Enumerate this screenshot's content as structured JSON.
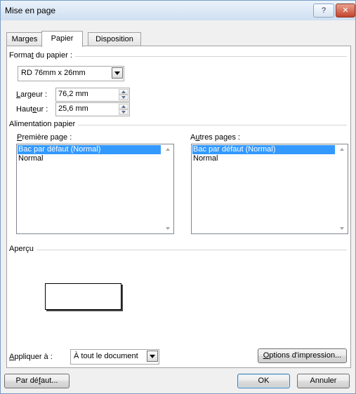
{
  "window": {
    "title": "Mise en page",
    "help_label": "?",
    "close_label": "✕"
  },
  "tabs": [
    {
      "label": "Marges"
    },
    {
      "label": "Papier"
    },
    {
      "label": "Disposition"
    }
  ],
  "format": {
    "group_pre": "Forma",
    "group_acc": "t",
    "group_post": " du papier :",
    "paper_value": "RD 76mm x 26mm",
    "width_pre": "",
    "width_acc": "L",
    "width_post": "argeur :",
    "width_value": "76,2 mm",
    "height_pre": "Haut",
    "height_acc": "e",
    "height_post": "ur :",
    "height_value": "25,6 mm"
  },
  "feed": {
    "group_label": "Alimentation papier",
    "first_pre": "",
    "first_acc": "P",
    "first_post": "remière page :",
    "first_items": [
      "Bac par défaut (Normal)",
      "Normal"
    ],
    "other_pre": "A",
    "other_acc": "u",
    "other_post": "tres pages :",
    "other_items": [
      "Bac par défaut (Normal)",
      "Normal"
    ]
  },
  "preview": {
    "group_label": "Aperçu"
  },
  "apply": {
    "label_pre": "",
    "label_acc": "A",
    "label_post": "ppliquer à :",
    "value": "À tout le document",
    "print_options_pre": "",
    "print_options_acc": "O",
    "print_options_post": "ptions d'impression..."
  },
  "footer": {
    "default_pre": "Par dé",
    "default_acc": "f",
    "default_post": "aut...",
    "ok_label": "OK",
    "cancel_label": "Annuler"
  },
  "icons": {
    "help": "help-icon",
    "close": "close-icon",
    "dropdown": "chevron-down-icon"
  }
}
